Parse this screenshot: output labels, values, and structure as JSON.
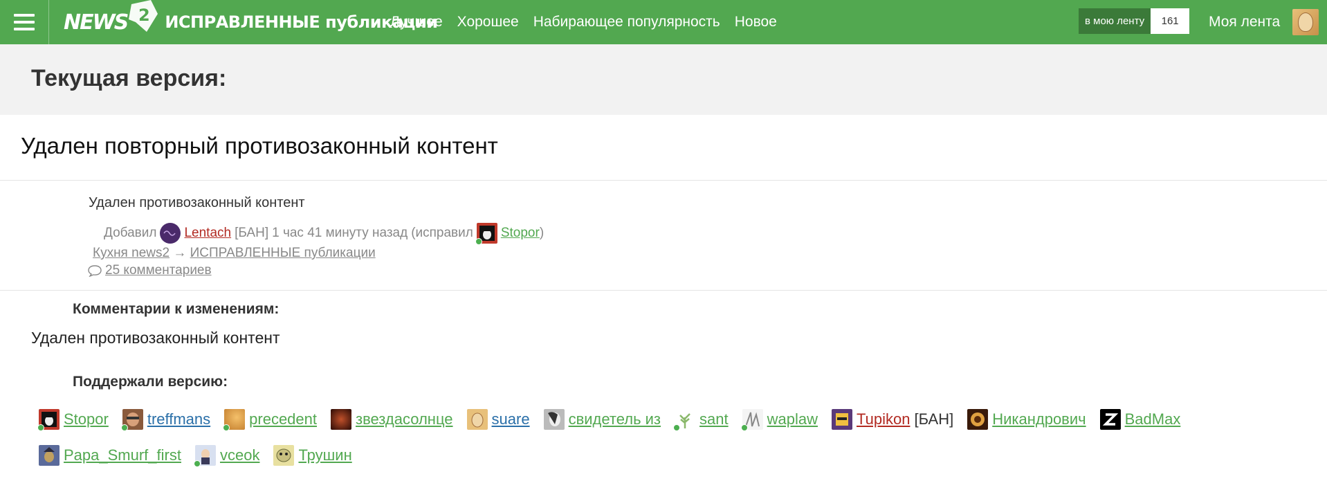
{
  "topbar": {
    "logo_text": "NEWS",
    "logo_suffix": "2",
    "section": "ИСПРАВЛЕННЫЕ публикации",
    "nav": [
      "Лучшее",
      "Хорошее",
      "Набирающее популярность",
      "Новое"
    ],
    "feed_button_label": "в мою ленту",
    "feed_button_count": "161",
    "my_feed": "Моя лента"
  },
  "header": {
    "title": "Текущая версия:"
  },
  "article": {
    "title": "Удален повторный противозаконный контент",
    "excerpt": "Удален противозаконный контент",
    "meta": {
      "added_prefix": "Добавил",
      "author": "Lentach",
      "author_status": "[БАН]",
      "time": "1 час 41 минуту назад",
      "fixed_prefix": "(исправил",
      "editor": "Stopor",
      "close_paren": ")"
    },
    "breadcrumb": {
      "from": "Кухня news2",
      "arrow": "→",
      "to": "ИСПРАВЛЕННЫЕ публикации"
    },
    "comments_link": "25 комментариев"
  },
  "change_comments": {
    "label": "Комментарии к изменениям:",
    "text": "Удален противозаконный контент"
  },
  "supporters": {
    "label": "Поддержали версию:",
    "row1": [
      {
        "name": "Stopor",
        "color": "green",
        "online": true
      },
      {
        "name": "treffmans",
        "color": "blue",
        "online": true
      },
      {
        "name": "precedent",
        "color": "green",
        "online": true
      },
      {
        "name": "звездасолнце",
        "color": "green",
        "online": false
      },
      {
        "name": "suare",
        "color": "blue",
        "online": false
      },
      {
        "name": "свидетель из",
        "color": "green",
        "online": false
      },
      {
        "name": "sant",
        "color": "green",
        "online": true
      },
      {
        "name": "waplaw",
        "color": "green",
        "online": true
      },
      {
        "name": "Tupikon",
        "color": "red",
        "online": false,
        "status": "[БАН]"
      },
      {
        "name": "Никандрович",
        "color": "green",
        "online": false
      },
      {
        "name": "BadMax",
        "color": "green",
        "online": false
      }
    ],
    "row2": [
      {
        "name": "Papa_Smurf_first",
        "color": "green",
        "online": false
      },
      {
        "name": "vceok",
        "color": "green",
        "online": true
      },
      {
        "name": "Трушин",
        "color": "green",
        "online": false
      }
    ]
  },
  "colors": {
    "topbar": "#52a850",
    "link_green": "#52a850",
    "link_red": "#b22a22",
    "link_blue": "#2a6fa8"
  }
}
